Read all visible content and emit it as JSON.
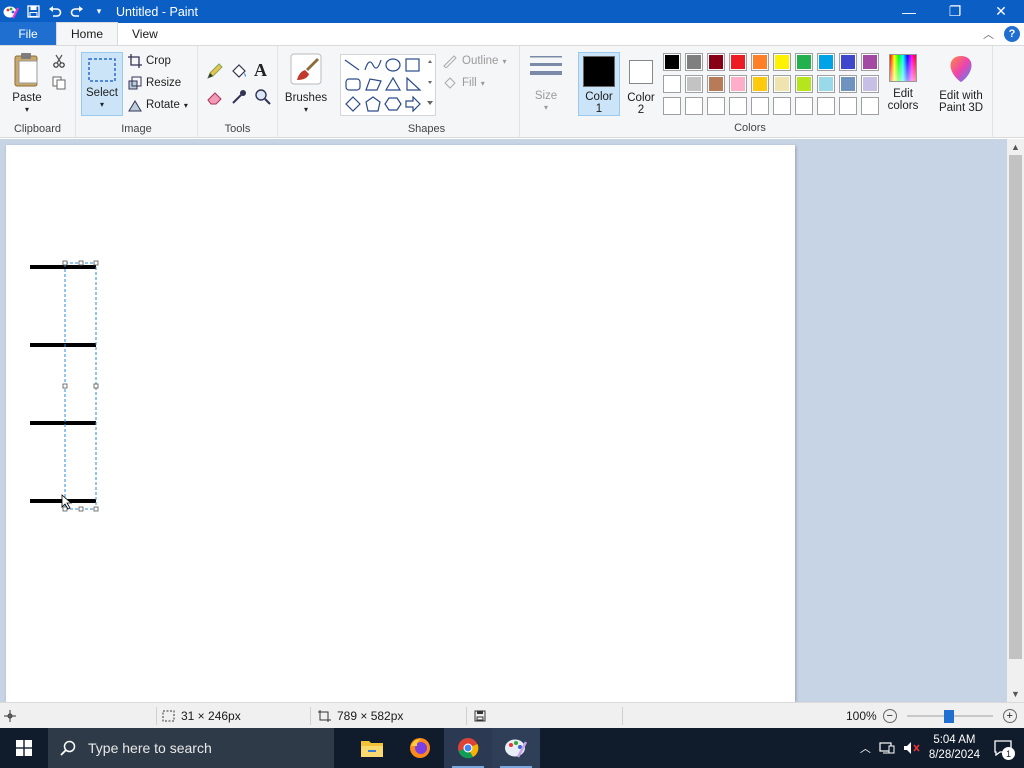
{
  "titlebar": {
    "title": "Untitled - Paint",
    "minimize": "—",
    "restore": "❐",
    "close": "✕"
  },
  "tabs": {
    "file": "File",
    "home": "Home",
    "view": "View",
    "help": "?"
  },
  "ribbon": {
    "clipboard": {
      "label": "Clipboard",
      "paste": "Paste"
    },
    "image": {
      "label": "Image",
      "select": "Select",
      "crop": "Crop",
      "resize": "Resize",
      "rotate": "Rotate"
    },
    "tools": {
      "label": "Tools"
    },
    "brushes": {
      "label": "Brushes"
    },
    "shapes": {
      "label": "Shapes",
      "outline": "Outline",
      "fill": "Fill"
    },
    "size": {
      "label": "Size"
    },
    "color1": {
      "label_line1": "Color",
      "label_line2": "1",
      "value": "#000000"
    },
    "color2": {
      "label_line1": "Color",
      "label_line2": "2",
      "value": "#ffffff"
    },
    "colors": {
      "label": "Colors",
      "row1": [
        "#000000",
        "#7f7f7f",
        "#880015",
        "#ed1c24",
        "#ff7f27",
        "#fff200",
        "#22b14c",
        "#00a2e8",
        "#3f48cc",
        "#a349a4"
      ],
      "row2": [
        "#ffffff",
        "#c3c3c3",
        "#b97a57",
        "#ffaec9",
        "#ffc90e",
        "#efe4b0",
        "#b5e61d",
        "#99d9ea",
        "#7092be",
        "#c8bfe7"
      ]
    },
    "edit_colors": {
      "line1": "Edit",
      "line2": "colors"
    },
    "paint3d": {
      "line1": "Edit with",
      "line2": "Paint 3D"
    }
  },
  "status": {
    "selection_size": "31 × 246px",
    "canvas_size": "789 × 582px",
    "zoom": "100%"
  },
  "taskbar": {
    "search_placeholder": "Type here to search",
    "time": "5:04 AM",
    "date": "8/28/2024",
    "notifications": "1"
  }
}
